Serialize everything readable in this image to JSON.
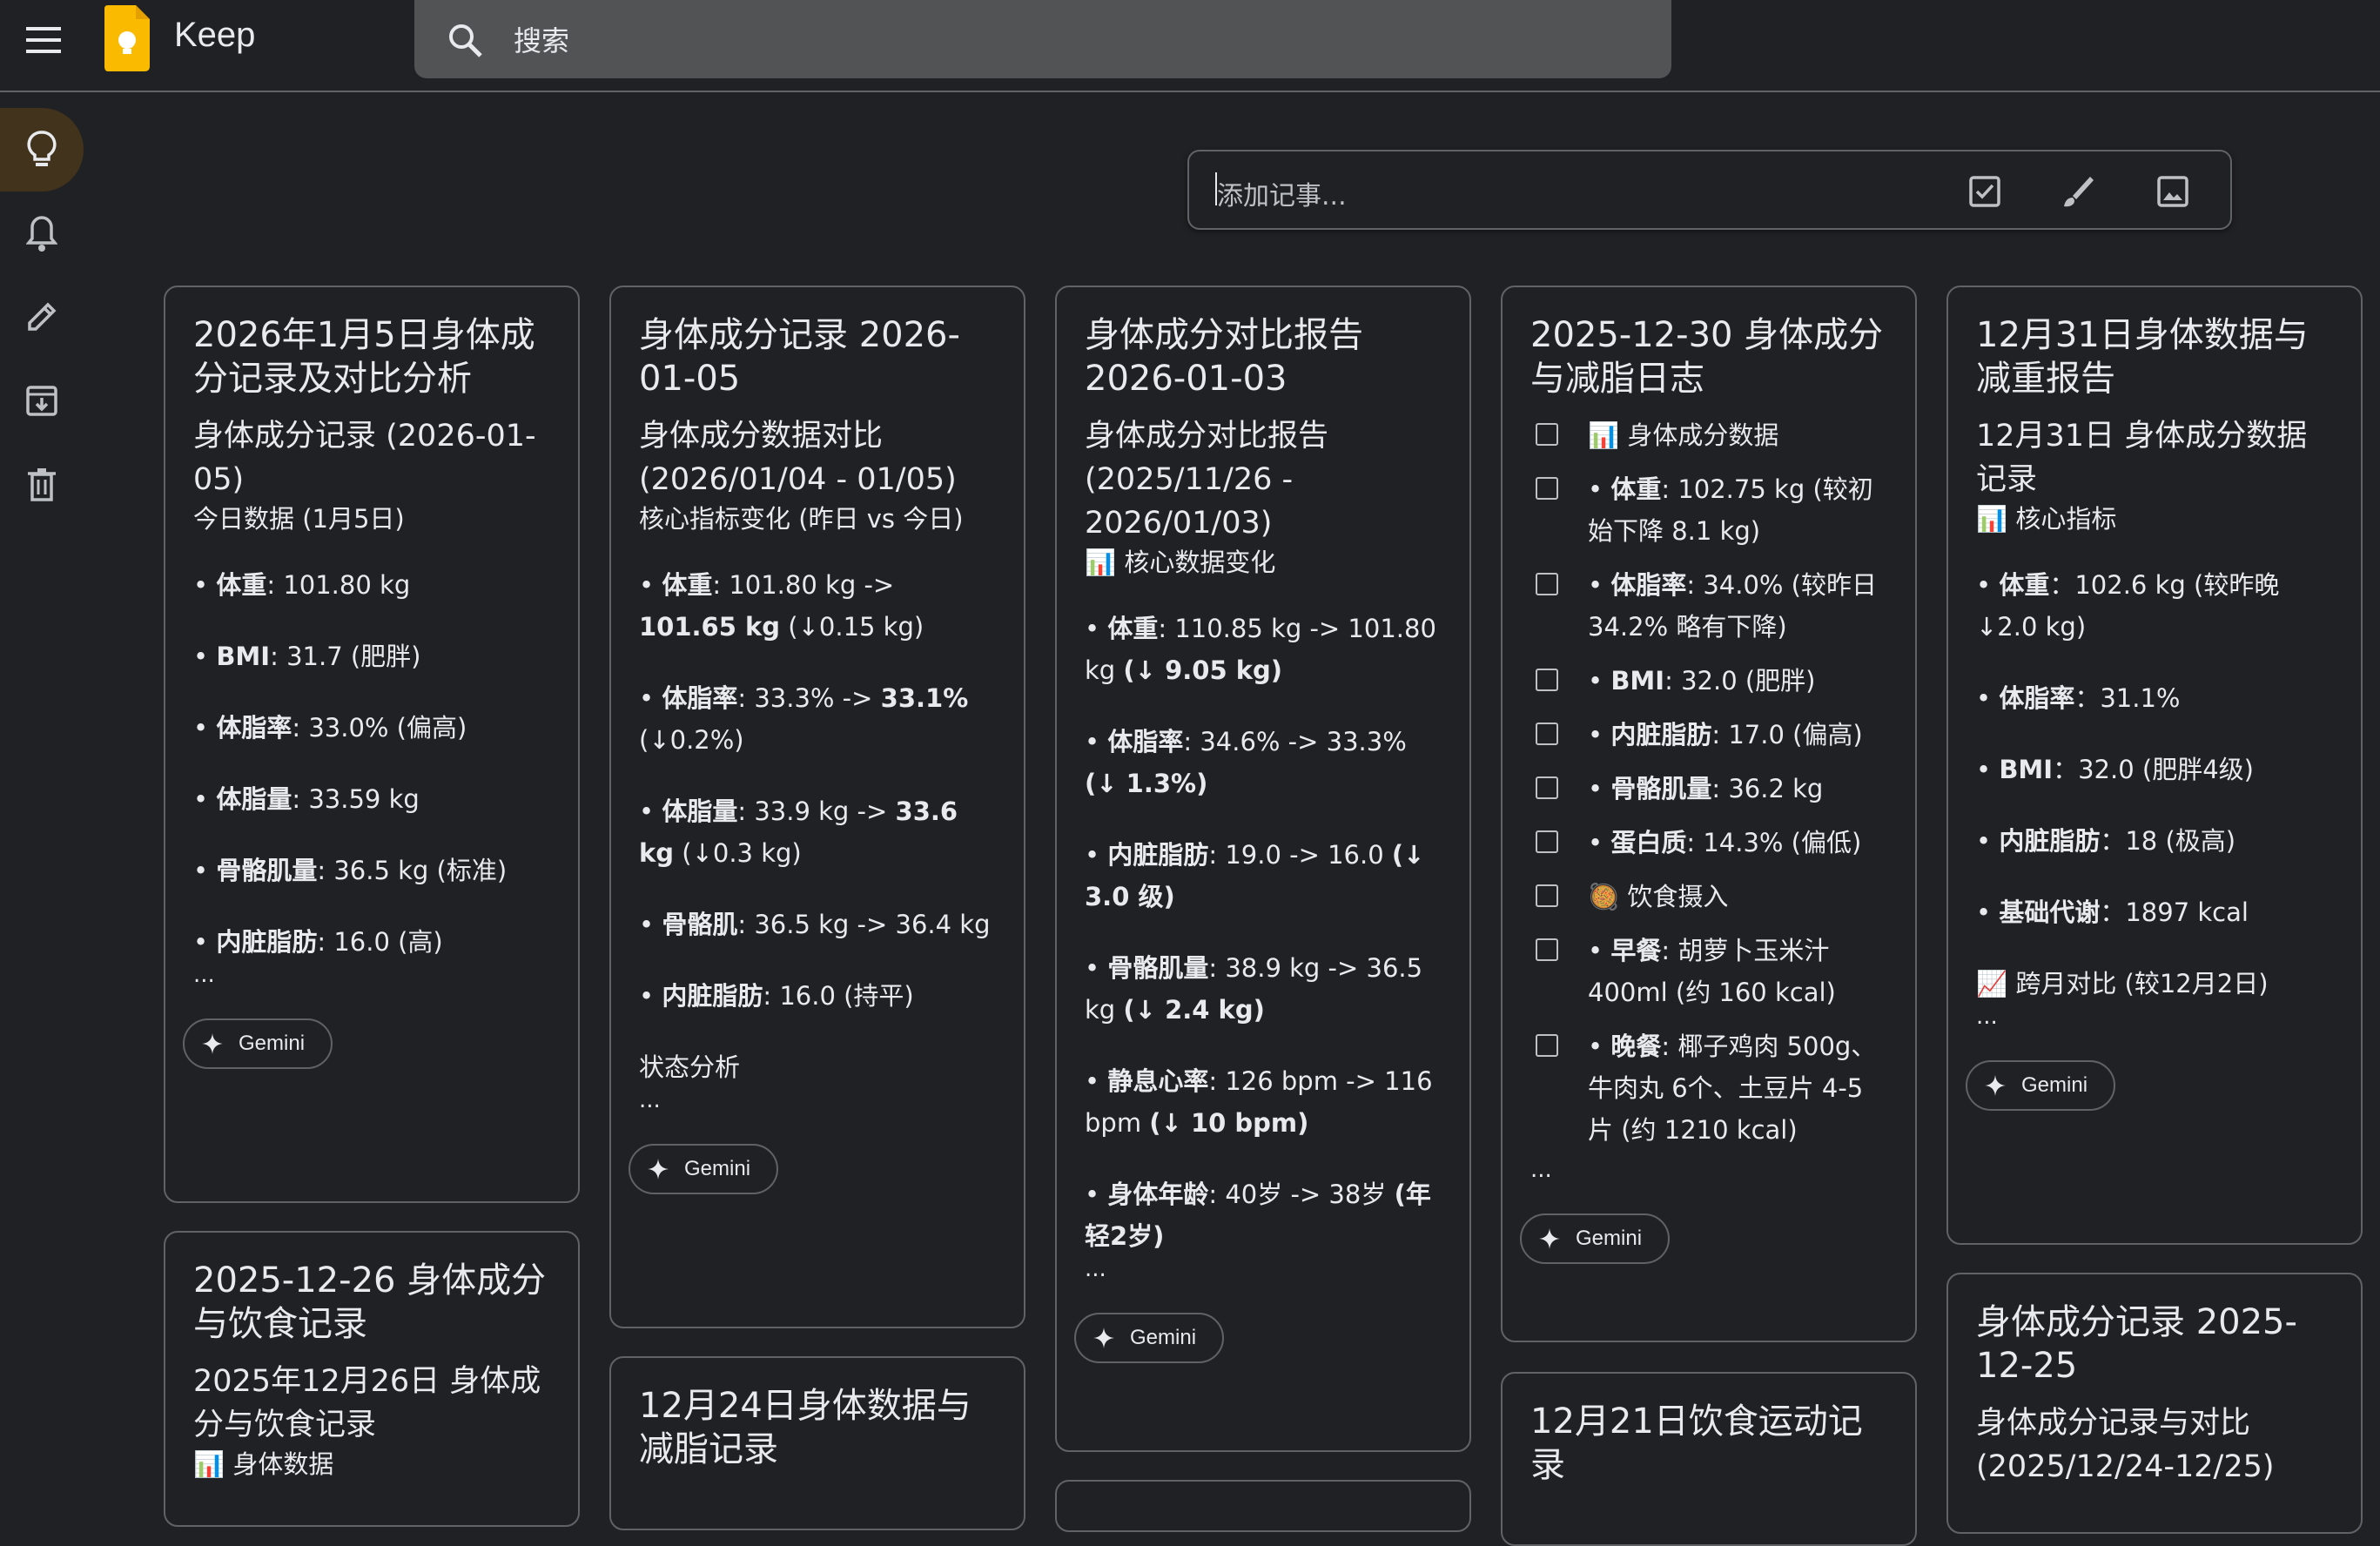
{
  "header": {
    "app_name": "Keep",
    "search_placeholder": "搜索"
  },
  "take_note": {
    "placeholder": "添加记事..."
  },
  "gemini_label": "Gemini",
  "ellipsis": "...",
  "notes": {
    "n1": {
      "title": "2026年1月5日身体成分记录及对比分析",
      "sub": "身体成分记录 (2026-01-05)",
      "small": "今日数据 (1月5日)",
      "l1k": "体重",
      "l1v": ": 101.80 kg",
      "l2k": "BMI",
      "l2v": ": 31.7 (肥胖)",
      "l3k": "体脂率",
      "l3v": ": 33.0% (偏高)",
      "l4k": "体脂量",
      "l4v": ": 33.59 kg",
      "l5k": "骨骼肌量",
      "l5v": ": 36.5 kg (标准)",
      "l6k": "内脏脂肪",
      "l6v": ": 16.0 (高)"
    },
    "n2": {
      "title": "身体成分记录 2026-01-05",
      "sub": "身体成分数据对比 (2026/01/04 - 01/05)",
      "small": "核心指标变化 (昨日 vs 今日)",
      "l1k": "体重",
      "l1a": ": 101.80 kg -> ",
      "l1b": "101.65 kg",
      "l1c": " (↓0.15 kg)",
      "l2k": "体脂率",
      "l2a": ": 33.3% -> ",
      "l2b": "33.1%",
      "l2c": " (↓0.2%)",
      "l3k": "体脂量",
      "l3a": ": 33.9 kg -> ",
      "l3b": "33.6 kg",
      "l3c": " (↓0.3 kg)",
      "l4k": "骨骼肌",
      "l4v": ": 36.5 kg -> 36.4 kg",
      "l5k": "内脏脂肪",
      "l5v": ": 16.0 (持平)",
      "status": "状态分析"
    },
    "n3": {
      "title": "身体成分对比报告 2026-01-03",
      "sub": "身体成分对比报告 (2025/11/26 - 2026/01/03)",
      "small": "📊 核心数据变化",
      "l1k": "体重",
      "l1a": ": 110.85 kg -> 101.80 kg ",
      "l1b": "(↓ 9.05 kg)",
      "l2k": "体脂率",
      "l2a": ": 34.6% -> 33.3% ",
      "l2b": "(↓ 1.3%)",
      "l3k": "内脏脂肪",
      "l3a": ": 19.0 -> 16.0 ",
      "l3b": "(↓ 3.0 级)",
      "l4k": "骨骼肌量",
      "l4a": ": 38.9 kg -> 36.5 kg ",
      "l4b": "(↓ 2.4 kg)",
      "l5k": "静息心率",
      "l5a": ": 126 bpm -> 116 bpm ",
      "l5b": "(↓ 10 bpm)",
      "l6k": "身体年龄",
      "l6a": ": 40岁 -> 38岁 ",
      "l6b": "(年轻2岁)"
    },
    "n4": {
      "title": "2025-12-30 身体成分与减脂日志",
      "items": [
        {
          "k": "",
          "v": "📊 身体成分数据"
        },
        {
          "k": "体重",
          "v": ": 102.75 kg (较初始下降 8.1 kg)"
        },
        {
          "k": "体脂率",
          "v": ": 34.0% (较昨日34.2% 略有下降)"
        },
        {
          "k": "BMI",
          "v": ": 32.0 (肥胖)"
        },
        {
          "k": "内脏脂肪",
          "v": ": 17.0 (偏高)"
        },
        {
          "k": "骨骼肌量",
          "v": ": 36.2 kg"
        },
        {
          "k": "蛋白质",
          "v": ": 14.3% (偏低)"
        },
        {
          "k": "",
          "v": "🥘 饮食摄入"
        },
        {
          "k": "早餐",
          "v": ": 胡萝卜玉米汁400ml (约 160 kcal)"
        },
        {
          "k": "晚餐",
          "v": ": 椰子鸡肉 500g、牛肉丸 6个、土豆片 4-5片 (约 1210 kcal)"
        }
      ]
    },
    "n5": {
      "title": "12月31日身体数据与减重报告",
      "sub": "12月31日 身体成分数据记录",
      "small": "📊 核心指标",
      "l1k": "体重",
      "l1v": "：102.6 kg (较昨晚 ↓2.0 kg)",
      "l2k": "体脂率",
      "l2v": "：31.1%",
      "l3k": "BMI",
      "l3v": "：32.0 (肥胖4级)",
      "l4k": "内脏脂肪",
      "l4v": "：18 (极高)",
      "l5k": "基础代谢",
      "l5v": "：1897 kcal",
      "l6": "📈 跨月对比 (较12月2日)"
    },
    "n6": {
      "title": "2025-12-26 身体成分与饮食记录",
      "sub": "2025年12月26日 身体成分与饮食记录",
      "small": "📊 身体数据"
    },
    "n7": {
      "title": "12月24日身体数据与减脂记录"
    },
    "n8": {
      "title": "12月21日饮食运动记录"
    },
    "n9": {
      "title": "身体成分记录 2025-12-25",
      "sub": "身体成分记录与对比 (2025/12/24-12/25)"
    }
  }
}
